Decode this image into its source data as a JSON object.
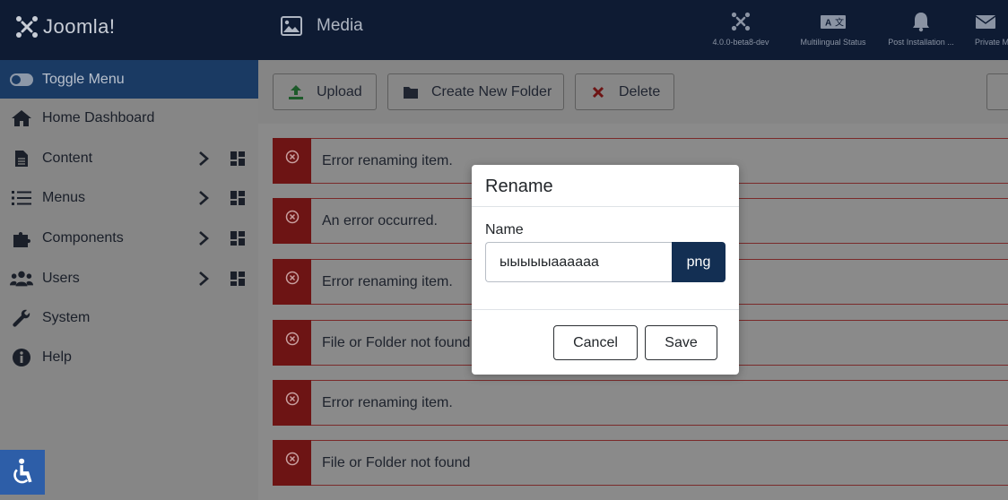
{
  "header": {
    "logo_text": "Joomla!",
    "page_title": "Media",
    "items": [
      {
        "label": "4.0.0-beta8-dev",
        "icon": "joomla-icon"
      },
      {
        "label": "Multilingual Status",
        "icon": "language-icon"
      },
      {
        "label": "Post Installation ...",
        "icon": "bell-icon"
      },
      {
        "label": "Private M",
        "icon": "envelope-icon"
      }
    ]
  },
  "sidebar": {
    "toggle_label": "Toggle Menu",
    "items": [
      {
        "label": "Home Dashboard",
        "icon": "home-icon"
      },
      {
        "label": "Content",
        "icon": "file-icon"
      },
      {
        "label": "Menus",
        "icon": "list-icon"
      },
      {
        "label": "Components",
        "icon": "puzzle-icon"
      },
      {
        "label": "Users",
        "icon": "users-icon"
      },
      {
        "label": "System",
        "icon": "wrench-icon"
      },
      {
        "label": "Help",
        "icon": "info-icon"
      }
    ]
  },
  "toolbar": {
    "upload": "Upload",
    "new_folder": "Create New Folder",
    "delete": "Delete"
  },
  "alerts": [
    "Error renaming item.",
    "An error occurred.",
    "Error renaming item.",
    "File or Folder not found",
    "Error renaming item.",
    "File or Folder not found"
  ],
  "modal": {
    "title": "Rename",
    "field_label": "Name",
    "name_value": "ыыыыыaaaaaa",
    "extension": "png",
    "cancel": "Cancel",
    "save": "Save"
  },
  "colors": {
    "header_bg": "#0e1b33",
    "toggle_bg": "#1a3a63",
    "alert_bar": "#6d1414",
    "ext_bg": "#132f53",
    "a11y_bg": "#2d5ea8"
  }
}
